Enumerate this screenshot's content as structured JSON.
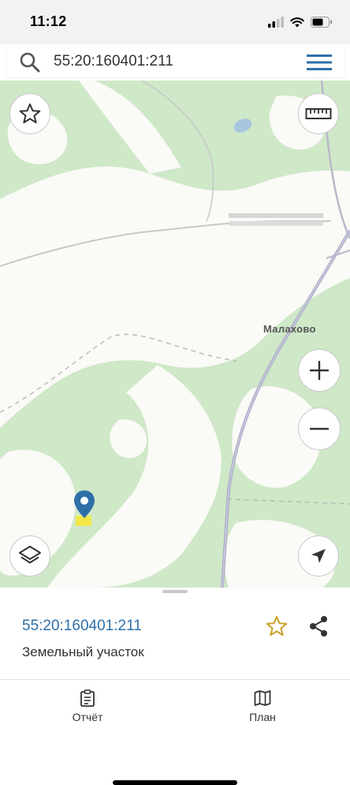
{
  "status_bar": {
    "time": "11:12"
  },
  "search": {
    "query": "55:20:160401:211"
  },
  "map": {
    "place_label": "Малахово"
  },
  "selected_parcel": {
    "cadastral_number": "55:20:160401:211",
    "type": "Земельный участок"
  },
  "bottom_tabs": [
    {
      "label": "Отчёт",
      "icon": "report-icon"
    },
    {
      "label": "План",
      "icon": "map-icon"
    }
  ],
  "colors": {
    "accent": "#2f6fa8",
    "favorite": "#c9a227",
    "pin": "#2f6fa8",
    "parcel_highlight": "#f2e84a",
    "forest": "#cfe8c8"
  }
}
